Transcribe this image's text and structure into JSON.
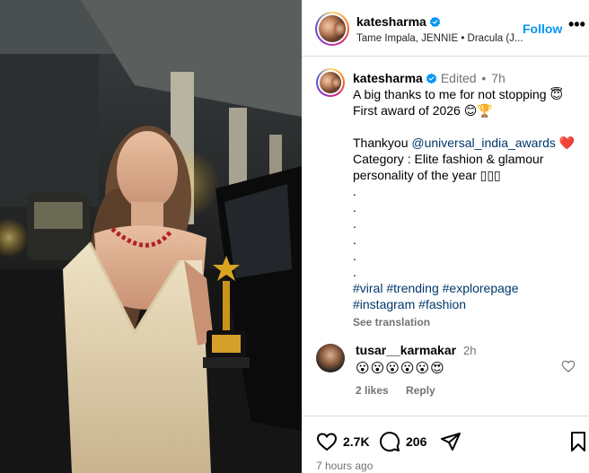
{
  "header": {
    "username": "katesharma",
    "music": "Tame Impala, JENNIE • Dracula (J...",
    "follow_label": "Follow",
    "more_label": "•••"
  },
  "caption": {
    "username": "katesharma",
    "edited": "Edited",
    "dot": "•",
    "time": "7h",
    "lines": [
      "A big thanks to me for not stopping 😇",
      "First award of 2026 😊🏆",
      "",
      "Thankyou ",
      "Category : Elite fashion & glamour personality of the year ▯▯▯",
      ".",
      ".",
      ".",
      ".",
      ".",
      "."
    ],
    "mention": "@universal_india_awards",
    "mention_suffix": " ❤️",
    "hashtags_line1": [
      "#viral",
      "#trending",
      "#explorepage"
    ],
    "hashtags_line2": [
      "#instagram",
      "#fashion"
    ],
    "see_translation": "See translation"
  },
  "comment": {
    "username": "tusar__karmakar",
    "time": "2h",
    "text": "😮😮😮😮😮😍",
    "likes": "2 likes",
    "reply": "Reply"
  },
  "actions": {
    "like_count": "2.7K",
    "comment_count": "206",
    "posted": "7 hours ago"
  },
  "colors": {
    "link": "#0095f6",
    "hashtag": "#00376b",
    "muted": "#737373",
    "verified": "#0095f6",
    "divider": "#dbdbdb"
  }
}
